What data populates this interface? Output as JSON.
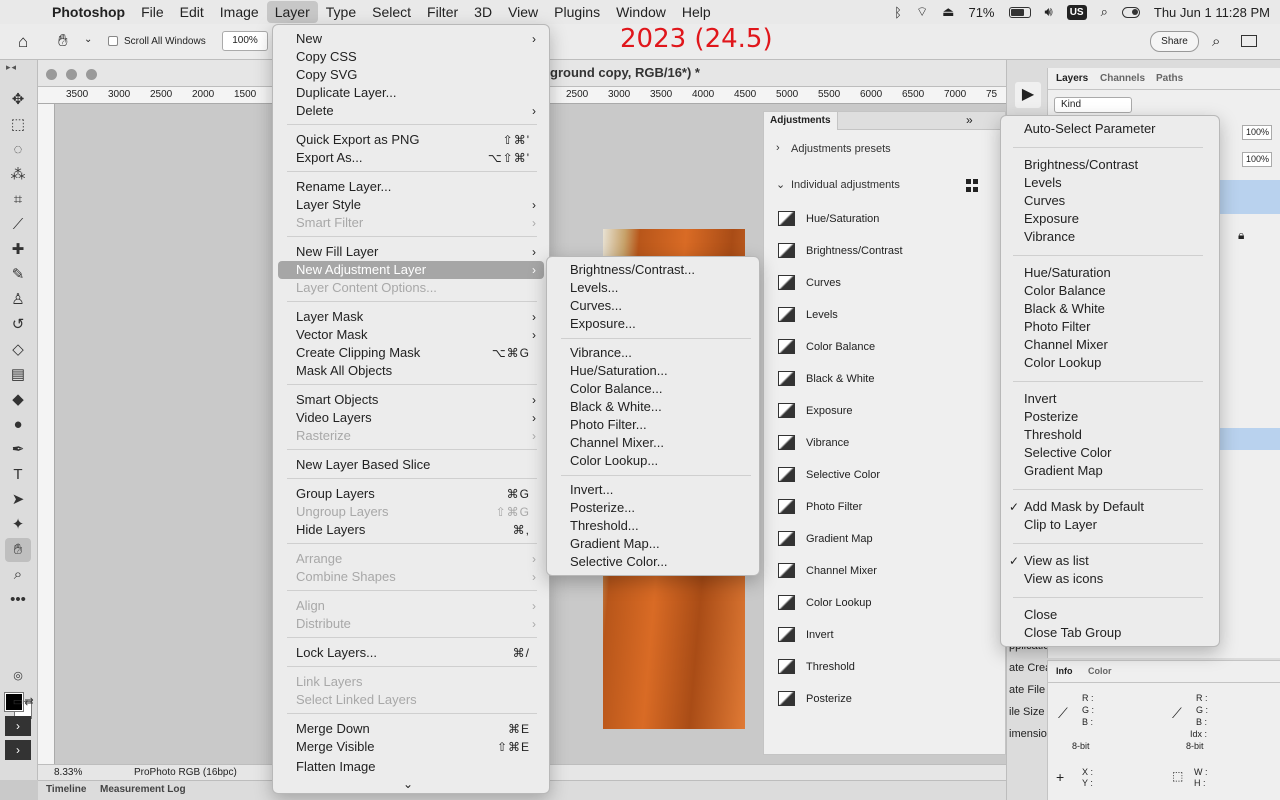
{
  "menubar": {
    "app": "Photoshop",
    "items": [
      "File",
      "Edit",
      "Image",
      "Layer",
      "Type",
      "Select",
      "Filter",
      "3D",
      "View",
      "Plugins",
      "Window",
      "Help"
    ],
    "active": "Layer",
    "battery": "71%",
    "input_source": "US",
    "clock": "Thu Jun 1  11:28 PM"
  },
  "options_bar": {
    "scroll_all_windows": "Scroll All Windows",
    "zoom": "100%",
    "version_overlay": "2023 (24.5)",
    "share": "Share"
  },
  "document": {
    "title": "ground copy, RGB/16*) *",
    "ruler_labels": [
      "3500",
      "3000",
      "2500",
      "2000",
      "1500",
      "2500",
      "3000",
      "3500",
      "4000",
      "4500",
      "5000",
      "5500",
      "6000",
      "6500",
      "7000",
      "75"
    ],
    "status_zoom": "8.33%",
    "status_profile": "ProPhoto RGB (16bpc)"
  },
  "bottom_tabs": [
    "Timeline",
    "Measurement Log"
  ],
  "layer_menu": {
    "items": [
      {
        "label": "New",
        "arrow": true
      },
      {
        "label": "Copy CSS"
      },
      {
        "label": "Copy SVG"
      },
      {
        "label": "Duplicate Layer..."
      },
      {
        "label": "Delete",
        "arrow": true
      },
      {
        "label": "Quick Export as PNG",
        "shortcut": "⇧⌘'"
      },
      {
        "label": "Export As...",
        "shortcut": "⌥⇧⌘'"
      },
      {
        "label": "Rename Layer..."
      },
      {
        "label": "Layer Style",
        "arrow": true
      },
      {
        "label": "Smart Filter",
        "arrow": true,
        "disabled": true
      },
      {
        "label": "New Fill Layer",
        "arrow": true
      },
      {
        "label": "New Adjustment Layer",
        "arrow": true,
        "highlighted": true
      },
      {
        "label": "Layer Content Options...",
        "disabled": true
      },
      {
        "label": "Layer Mask",
        "arrow": true
      },
      {
        "label": "Vector Mask",
        "arrow": true
      },
      {
        "label": "Create Clipping Mask",
        "shortcut": "⌥⌘G"
      },
      {
        "label": "Mask All Objects"
      },
      {
        "label": "Smart Objects",
        "arrow": true
      },
      {
        "label": "Video Layers",
        "arrow": true
      },
      {
        "label": "Rasterize",
        "arrow": true,
        "disabled": true
      },
      {
        "label": "New Layer Based Slice"
      },
      {
        "label": "Group Layers",
        "shortcut": "⌘G"
      },
      {
        "label": "Ungroup Layers",
        "shortcut": "⇧⌘G",
        "disabled": true
      },
      {
        "label": "Hide Layers",
        "shortcut": "⌘,"
      },
      {
        "label": "Arrange",
        "arrow": true,
        "disabled": true
      },
      {
        "label": "Combine Shapes",
        "arrow": true,
        "disabled": true
      },
      {
        "label": "Align",
        "arrow": true,
        "disabled": true
      },
      {
        "label": "Distribute",
        "arrow": true,
        "disabled": true
      },
      {
        "label": "Lock Layers...",
        "shortcut": "⌘/"
      },
      {
        "label": "Link Layers",
        "disabled": true
      },
      {
        "label": "Select Linked Layers",
        "disabled": true
      },
      {
        "label": "Merge Down",
        "shortcut": "⌘E"
      },
      {
        "label": "Merge Visible",
        "shortcut": "⇧⌘E"
      },
      {
        "label": "Flatten Image"
      }
    ]
  },
  "adjustment_submenu": {
    "items": [
      "Brightness/Contrast...",
      "Levels...",
      "Curves...",
      "Exposure...",
      "Vibrance...",
      "Hue/Saturation...",
      "Color Balance...",
      "Black & White...",
      "Photo Filter...",
      "Channel Mixer...",
      "Color Lookup...",
      "Invert...",
      "Posterize...",
      "Threshold...",
      "Gradient Map...",
      "Selective Color..."
    ]
  },
  "adjustments_panel": {
    "tab": "Adjustments",
    "presets_label": "Adjustments presets",
    "individual_label": "Individual adjustments",
    "items": [
      "Hue/Saturation",
      "Brightness/Contrast",
      "Curves",
      "Levels",
      "Color Balance",
      "Black & White",
      "Exposure",
      "Vibrance",
      "Selective Color",
      "Photo Filter",
      "Gradient Map",
      "Channel Mixer",
      "Color Lookup",
      "Invert",
      "Threshold",
      "Posterize"
    ]
  },
  "flyout_menu": {
    "items": [
      {
        "label": "Auto-Select Parameter"
      },
      {
        "label": "Brightness/Contrast"
      },
      {
        "label": "Levels"
      },
      {
        "label": "Curves"
      },
      {
        "label": "Exposure"
      },
      {
        "label": "Vibrance"
      },
      {
        "label": "Hue/Saturation"
      },
      {
        "label": "Color Balance"
      },
      {
        "label": "Black & White"
      },
      {
        "label": "Photo Filter"
      },
      {
        "label": "Channel Mixer"
      },
      {
        "label": "Color Lookup"
      },
      {
        "label": "Invert"
      },
      {
        "label": "Posterize"
      },
      {
        "label": "Threshold"
      },
      {
        "label": "Selective Color"
      },
      {
        "label": "Gradient Map"
      },
      {
        "label": "Add Mask by Default",
        "checked": true
      },
      {
        "label": "Clip to Layer"
      },
      {
        "label": "View as list",
        "checked": true
      },
      {
        "label": "View as icons"
      },
      {
        "label": "Close"
      },
      {
        "label": "Close Tab Group"
      }
    ]
  },
  "layers_panel": {
    "tabs": [
      "Layers",
      "Channels",
      "Paths"
    ],
    "filter": "Kind",
    "opacity": "100%",
    "fill": "100%"
  },
  "info_panel": {
    "tabs": [
      "Info",
      "Color"
    ],
    "rgb_labels": [
      "R :",
      "G :",
      "B :"
    ],
    "bit_depth": "8-bit",
    "idx_label": "Idx :",
    "xy_labels": [
      "X :",
      "Y :"
    ],
    "wh_labels": [
      "W :",
      "H :"
    ]
  },
  "clipped_texts": [
    "pplicatio",
    "ate Crea",
    "ate File",
    "ile Size",
    "imensio"
  ]
}
